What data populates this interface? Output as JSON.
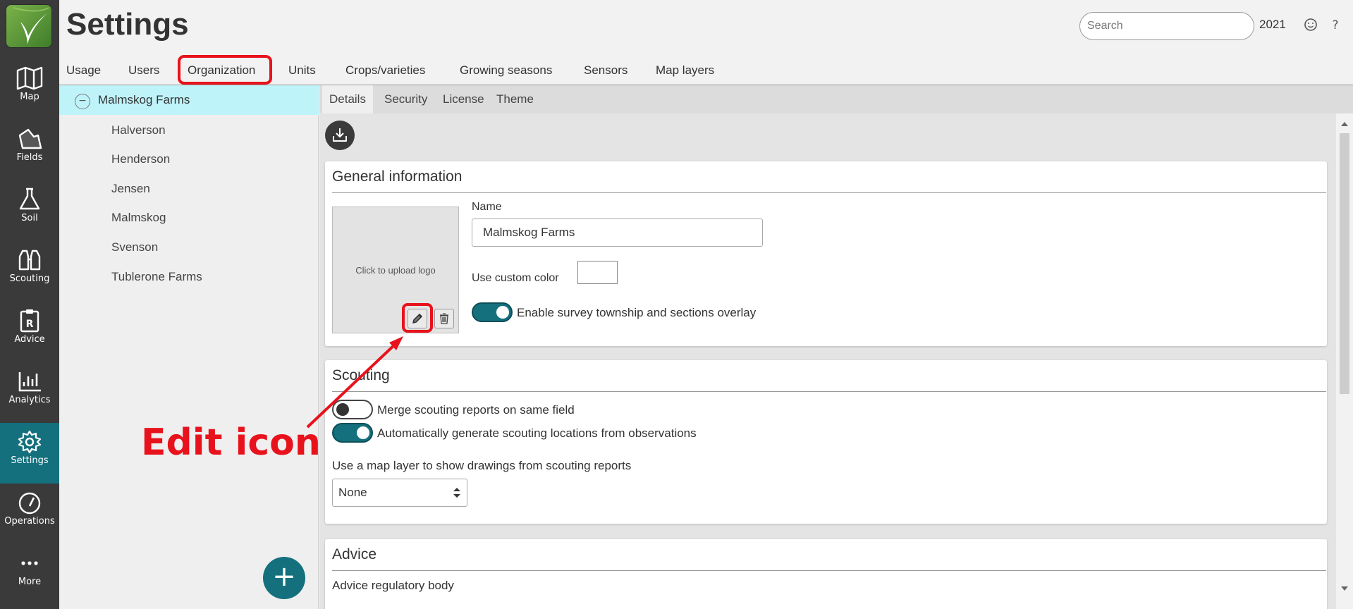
{
  "app": {
    "title": "Settings"
  },
  "nav": [
    {
      "label": "Map",
      "icon": "map-icon"
    },
    {
      "label": "Fields",
      "icon": "fields-icon"
    },
    {
      "label": "Soil",
      "icon": "flask-icon"
    },
    {
      "label": "Scouting",
      "icon": "binoculars-icon"
    },
    {
      "label": "Advice",
      "icon": "prescription-icon"
    },
    {
      "label": "Analytics",
      "icon": "bar-chart-icon"
    },
    {
      "label": "Settings",
      "icon": "gear-icon",
      "active": true
    },
    {
      "label": "Operations",
      "icon": "gauge-icon"
    },
    {
      "label": "More",
      "icon": "more-dots-icon"
    }
  ],
  "header": {
    "search_placeholder": "Search",
    "year": "2021"
  },
  "tabs": [
    "Usage",
    "Users",
    "Organization",
    "Units",
    "Crops/varieties",
    "Growing seasons",
    "Sensors",
    "Map layers"
  ],
  "active_tab": "Organization",
  "tree": {
    "root": "Malmskog Farms",
    "children": [
      "Halverson",
      "Henderson",
      "Jensen",
      "Malmskog",
      "Svenson",
      "Tublerone Farms"
    ]
  },
  "subtabs": [
    "Details",
    "Security",
    "License",
    "Theme"
  ],
  "active_subtab": "Details",
  "general": {
    "title": "General information",
    "upload_text": "Click to upload logo",
    "name_label": "Name",
    "name_value": "Malmskog Farms",
    "color_label": "Use custom color",
    "overlay_label": "Enable survey township and sections overlay",
    "overlay_on": true
  },
  "scouting": {
    "title": "Scouting",
    "merge_label": "Merge scouting reports on same field",
    "merge_on": false,
    "auto_label": "Automatically generate scouting locations from observations",
    "auto_on": true,
    "layer_label": "Use a map layer to show drawings from scouting reports",
    "layer_value": "None"
  },
  "advice": {
    "title": "Advice",
    "body_label": "Advice regulatory body"
  },
  "annotation": {
    "text": "Edit icon",
    "color": "#e8121c"
  },
  "colors": {
    "accent": "#14707d",
    "rail": "#3a3a3a",
    "highlight": "#e8121c"
  }
}
